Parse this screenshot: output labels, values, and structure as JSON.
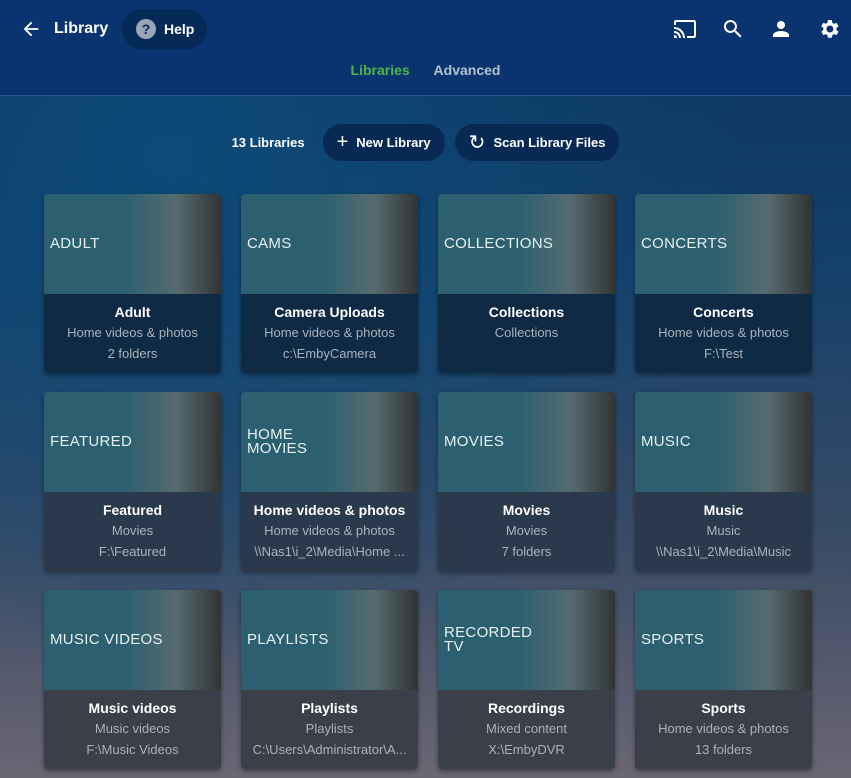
{
  "header": {
    "title": "Library",
    "help": "Help"
  },
  "tabs": [
    {
      "label": "Libraries"
    },
    {
      "label": "Advanced"
    }
  ],
  "toolbar": {
    "count": "13 Libraries",
    "new_library": "New Library",
    "scan": "Scan Library Files"
  },
  "libraries": [
    {
      "image_label": "ADULT",
      "name": "Adult",
      "type": "Home videos & photos",
      "location": "2 folders"
    },
    {
      "image_label": "CAMS",
      "name": "Camera Uploads",
      "type": "Home videos & photos",
      "location": "c:\\EmbyCamera"
    },
    {
      "image_label": "COLLECTIONS",
      "name": "Collections",
      "type": "Collections",
      "location": ""
    },
    {
      "image_label": "CONCERTS",
      "name": "Concerts",
      "type": "Home videos & photos",
      "location": "F:\\Test"
    },
    {
      "image_label": "FEATURED",
      "name": "Featured",
      "type": "Movies",
      "location": "F:\\Featured"
    },
    {
      "image_label": "HOME MOVIES",
      "name": "Home videos & photos",
      "type": "Home videos & photos",
      "location": "\\\\Nas1\\i_2\\Media\\Home ..."
    },
    {
      "image_label": "MOVIES",
      "name": "Movies",
      "type": "Movies",
      "location": "7 folders"
    },
    {
      "image_label": "MUSIC",
      "name": "Music",
      "type": "Music",
      "location": "\\\\Nas1\\i_2\\Media\\Music"
    },
    {
      "image_label": "MUSIC VIDEOS",
      "name": "Music videos",
      "type": "Music videos",
      "location": "F:\\Music Videos"
    },
    {
      "image_label": "PLAYLISTS",
      "name": "Playlists",
      "type": "Playlists",
      "location": "C:\\Users\\Administrator\\A..."
    },
    {
      "image_label": "RECORDED TV",
      "name": "Recordings",
      "type": "Mixed content",
      "location": "X:\\EmbyDVR"
    },
    {
      "image_label": "SPORTS",
      "name": "Sports",
      "type": "Home videos & photos",
      "location": "13 folders"
    }
  ]
}
